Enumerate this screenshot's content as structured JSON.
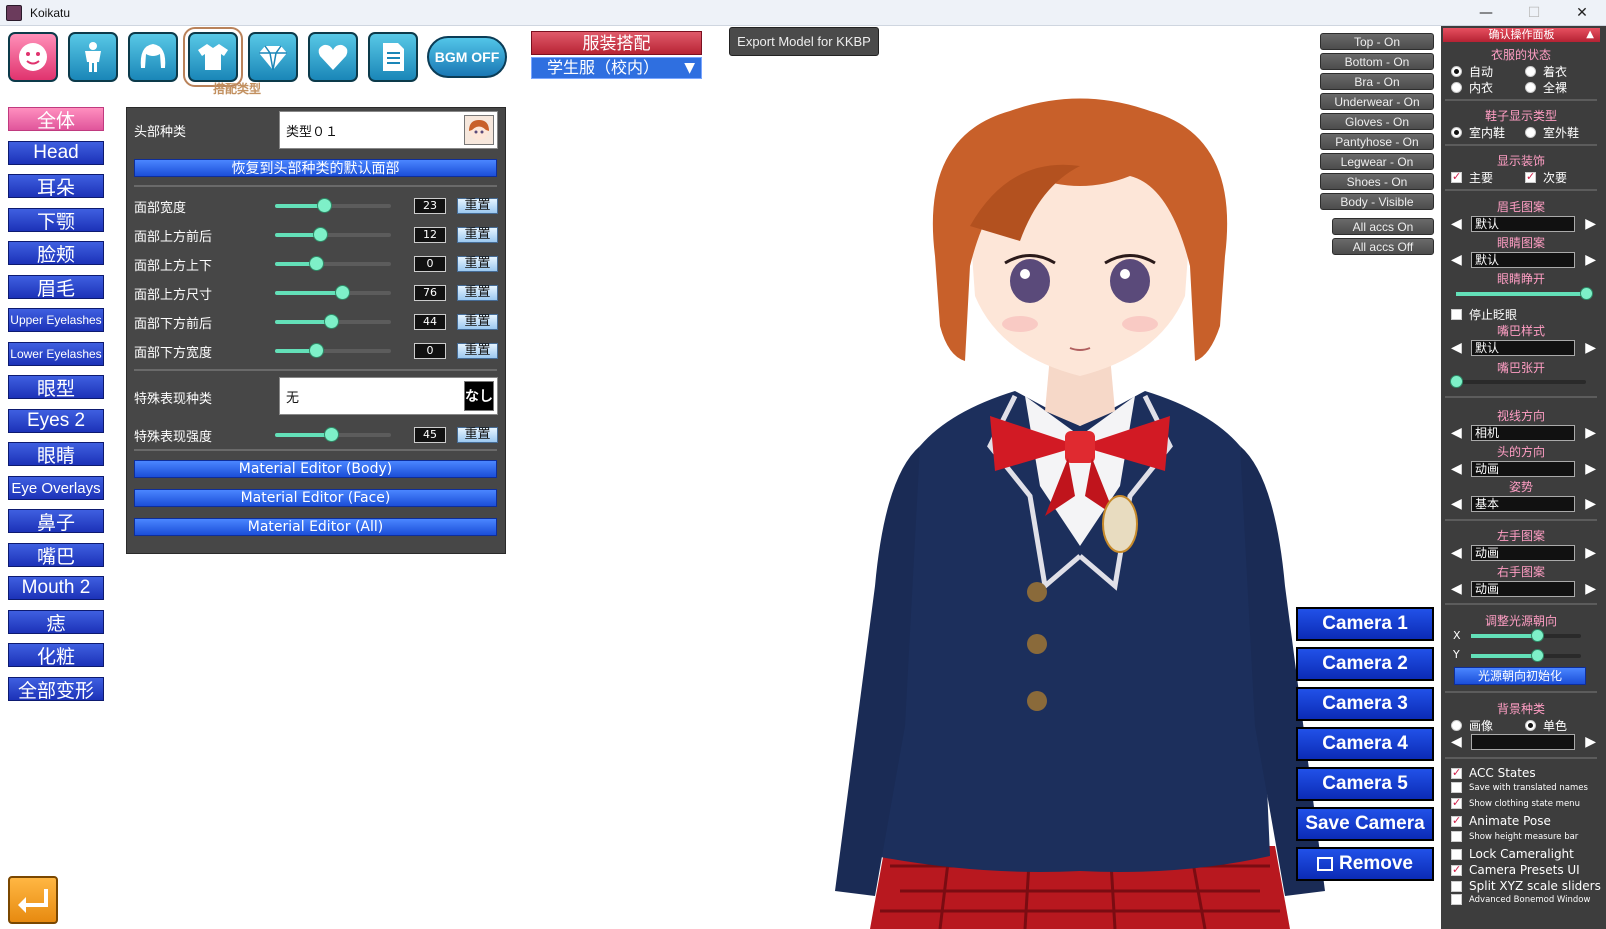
{
  "window": {
    "title": "Koikatu",
    "minimize": "—",
    "maximize": "☐",
    "close": "✕"
  },
  "top_icons": [
    {
      "name": "face-category-icon"
    },
    {
      "name": "body-category-icon"
    },
    {
      "name": "hair-category-icon"
    },
    {
      "name": "clothing-category-icon"
    },
    {
      "name": "accessory-category-icon"
    },
    {
      "name": "personality-category-icon"
    },
    {
      "name": "profile-category-icon"
    }
  ],
  "selected_icon_caption": "搭配类型",
  "bgm_button": "BGM OFF",
  "outfit": {
    "title": "服装搭配",
    "selected": "学生服（校内）",
    "arrow": "▼"
  },
  "export_button": "Export Model for KKBP",
  "categories": [
    "全体",
    "Head",
    "耳朵",
    "下颚",
    "脸颊",
    "眉毛",
    "Upper Eyelashes",
    "Lower Eyelashes",
    "眼型",
    "Eyes 2",
    "眼睛",
    "Eye Overlays",
    "鼻子",
    "嘴巴",
    "Mouth 2",
    "痣",
    "化粧",
    "全部变形"
  ],
  "head_panel": {
    "head_type_label": "头部种类",
    "head_type_value": "类型０１",
    "restore_button": "恢复到头部种类的默认面部",
    "sliders": [
      {
        "label": "面部宽度",
        "value": "23",
        "reset": "重置"
      },
      {
        "label": "面部上方前后",
        "value": "12",
        "reset": "重置"
      },
      {
        "label": "面部上方上下",
        "value": "0",
        "reset": "重置"
      },
      {
        "label": "面部上方尺寸",
        "value": "76",
        "reset": "重置"
      },
      {
        "label": "面部下方前后",
        "value": "44",
        "reset": "重置"
      },
      {
        "label": "面部下方宽度",
        "value": "0",
        "reset": "重置"
      }
    ],
    "expression_type_label": "特殊表现种类",
    "expression_type_value": "无",
    "expression_type_thumb": "なし",
    "expression_strength": {
      "label": "特殊表现强度",
      "value": "45",
      "reset": "重置"
    },
    "material_buttons": [
      "Material Editor (Body)",
      "Material Editor (Face)",
      "Material Editor (All)"
    ]
  },
  "clothing_states": [
    "Top - On",
    "Bottom - On",
    "Bra - On",
    "Underwear - On",
    "Gloves - On",
    "Pantyhose - On",
    "Legwear - On",
    "Shoes - On",
    "Body - Visible"
  ],
  "accs_buttons": [
    "All accs On",
    "All accs Off"
  ],
  "camera_buttons": [
    "Camera 1",
    "Camera 2",
    "Camera 3",
    "Camera 4",
    "Camera 5",
    "Save Camera",
    "Remove"
  ],
  "right_panel": {
    "header": "确认操作面板",
    "header_arrow": "▲",
    "clothing_state_title": "衣服的状态",
    "clothing_state_options": [
      "自动",
      "着衣",
      "内衣",
      "全裸"
    ],
    "shoe_title": "鞋子显示类型",
    "shoe_options": [
      "室内鞋",
      "室外鞋"
    ],
    "accessory_title": "显示装饰",
    "accessory_options": [
      "主要",
      "次要"
    ],
    "eyebrow_title": "眉毛图案",
    "eyebrow_value": "默认",
    "eye_title": "眼睛图案",
    "eye_value": "默认",
    "eye_open_title": "眼睛睁开",
    "stop_blink": "停止眨眼",
    "mouth_title": "嘴巴样式",
    "mouth_value": "默认",
    "mouth_open_title": "嘴巴张开",
    "gaze_title": "视线方向",
    "gaze_value": "相机",
    "head_dir_title": "头的方向",
    "head_dir_value": "动画",
    "pose_title": "姿势",
    "pose_value": "基本",
    "left_hand_title": "左手图案",
    "left_hand_value": "动画",
    "right_hand_title": "右手图案",
    "right_hand_value": "动画",
    "light_title": "调整光源朝向",
    "light_x_label": "X",
    "light_y_label": "Y",
    "light_reset_button": "光源朝向初始化",
    "bg_title": "背景种类",
    "bg_options": [
      "画像",
      "单色"
    ],
    "options": [
      {
        "label": "ACC States",
        "checked": true
      },
      {
        "label": "Save with translated names",
        "checked": false
      },
      {
        "label": "Show clothing state menu",
        "checked": true
      },
      {
        "label": "Animate Pose",
        "checked": true
      },
      {
        "label": "Show height measure bar",
        "checked": false
      },
      {
        "label": "Lock Cameralight",
        "checked": false
      },
      {
        "label": "Camera Presets UI",
        "checked": true
      },
      {
        "label": "Split XYZ scale sliders",
        "checked": false
      },
      {
        "label": "Advanced Bonemod Window",
        "checked": false
      }
    ]
  },
  "levels": {
    "eye_open": 1.0,
    "mouth_open": 0.0,
    "light_x": 0.6,
    "light_y": 0.6
  },
  "colors": {
    "accent_blue": "#1c32b8",
    "accent_pink": "#e0559b",
    "panel_dark": "#474747",
    "outfit_red": "#b82435"
  }
}
